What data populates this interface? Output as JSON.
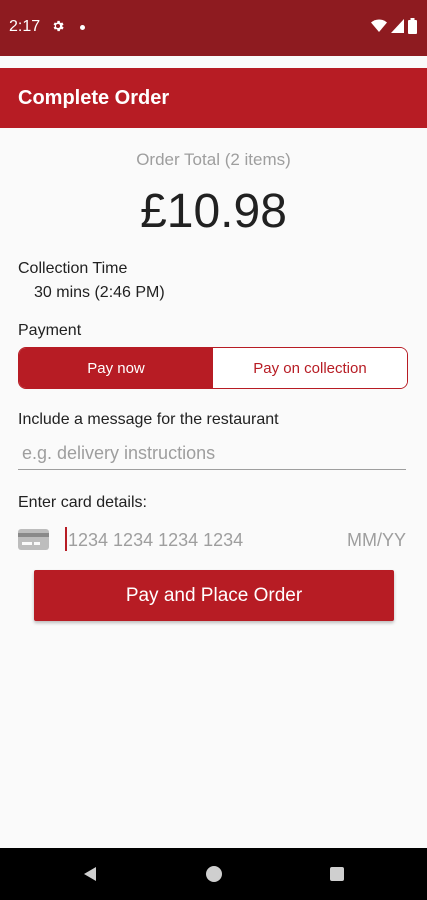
{
  "status_bar": {
    "time": "2:17",
    "icons": [
      "gear-icon",
      "notification-dot-icon",
      "wifi-icon",
      "signal-icon",
      "battery-icon"
    ]
  },
  "app_bar": {
    "title": "Complete Order"
  },
  "order": {
    "total_label": "Order Total (2 items)",
    "total_amount": "£10.98"
  },
  "collection": {
    "label": "Collection Time",
    "value": "30 mins (2:46 PM)"
  },
  "payment": {
    "label": "Payment",
    "options": [
      "Pay now",
      "Pay on collection"
    ],
    "selected": "Pay now"
  },
  "message": {
    "label": "Include a message for the restaurant",
    "placeholder": "e.g. delivery instructions",
    "value": ""
  },
  "card": {
    "label": "Enter card details:",
    "number_placeholder": "1234 1234 1234 1234",
    "expiry_placeholder": "MM/YY",
    "icon": "credit-card-icon"
  },
  "pay_button_label": "Pay and Place Order",
  "nav_bar": {
    "icons": [
      "back-icon",
      "home-icon",
      "recents-icon"
    ]
  },
  "colors": {
    "status_bar": "#8e1b20",
    "accent": "#b71c24",
    "background": "#fafafa",
    "muted_text": "#9e9e9e"
  }
}
